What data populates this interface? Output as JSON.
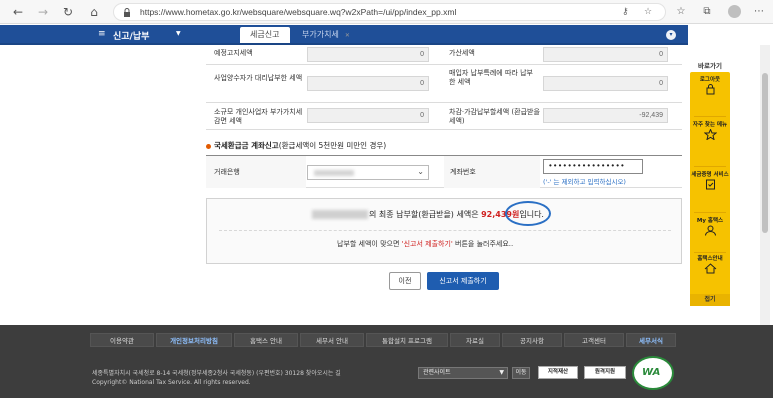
{
  "browser": {
    "url": "https://www.hometax.go.kr/websquare/websquare.wq?w2xPath=/ui/pp/index_pp.xml"
  },
  "header": {
    "menu_title": "신고/납부",
    "tabs": [
      {
        "label": "세금신고"
      },
      {
        "label": "부가가치세"
      }
    ]
  },
  "form": {
    "row1": {
      "label_left": "예정고지세액",
      "value_left": "0",
      "label_right": "가산세액",
      "value_right": "0"
    },
    "row2": {
      "label_left": "사업양수자가 대리납부한 세액",
      "value_left": "0",
      "label_right": "매입자 납부특례에 따라 납부한 세액",
      "value_right": "0"
    },
    "row3": {
      "label_left": "소규모 개인사업자 부가가치세 감면 세액",
      "value_left": "0",
      "label_right": "차감·가감납부할세액 (환급받을세액)",
      "value_right": "-92,439"
    }
  },
  "refund_section": {
    "title": "국세환급금 계좌신고",
    "subtitle": "(환급세액이 5천만원 미만인 경우)",
    "bank_label": "거래은행",
    "account_label": "계좌번호",
    "account_value": "••••••••••••••••",
    "account_hint": "('-' 는 제외하고 입력하십시오)"
  },
  "notice": {
    "msg_prefix": "의 최종 납부할(환급받을) 세액은",
    "amount": "92,439원",
    "msg_suffix": "입니다.",
    "msg2_prefix": "납부할 세액이 맞으면",
    "msg2_highlight": "'신고서 제출하기'",
    "msg2_suffix": "버튼을 눌러주세요.."
  },
  "buttons": {
    "prev": "이전",
    "submit": "신고서 제출하기"
  },
  "quick_menu": {
    "title": "바로가기",
    "items": [
      {
        "label": "로그아웃",
        "icon": "logout-icon"
      },
      {
        "label": "자주 찾는 메뉴",
        "icon": "star-icon"
      },
      {
        "label": "세금증명 서비스",
        "icon": "certificate-icon"
      },
      {
        "label": "My 홈택스",
        "icon": "person-icon"
      },
      {
        "label": "홈택스안내",
        "icon": "home-icon"
      }
    ],
    "fold": "접기"
  },
  "footer": {
    "links": [
      "이용약관",
      "개인정보처리방침",
      "홈택스 안내",
      "세무서 안내",
      "통합설치 프로그램",
      "자료실",
      "공지사항",
      "고객센터",
      "세무서식"
    ],
    "address": "세종특별자치시 국세청로 8-14 국세청(정부세종2청사 국세청동) (우편번호) 30128  찾아오시는 길",
    "copyright": "Copyright© National Tax Service. All rights reserved.",
    "site_select": "관련사이트",
    "go": "이동",
    "badge1": "지적재산",
    "badge2": "원격지원",
    "logo_text": "WA"
  },
  "colors": {
    "header_blue": "#1f4f98",
    "quick_yellow": "#f6c200",
    "amount_red": "#d0201f",
    "footer_dark": "#3d3d3d"
  }
}
